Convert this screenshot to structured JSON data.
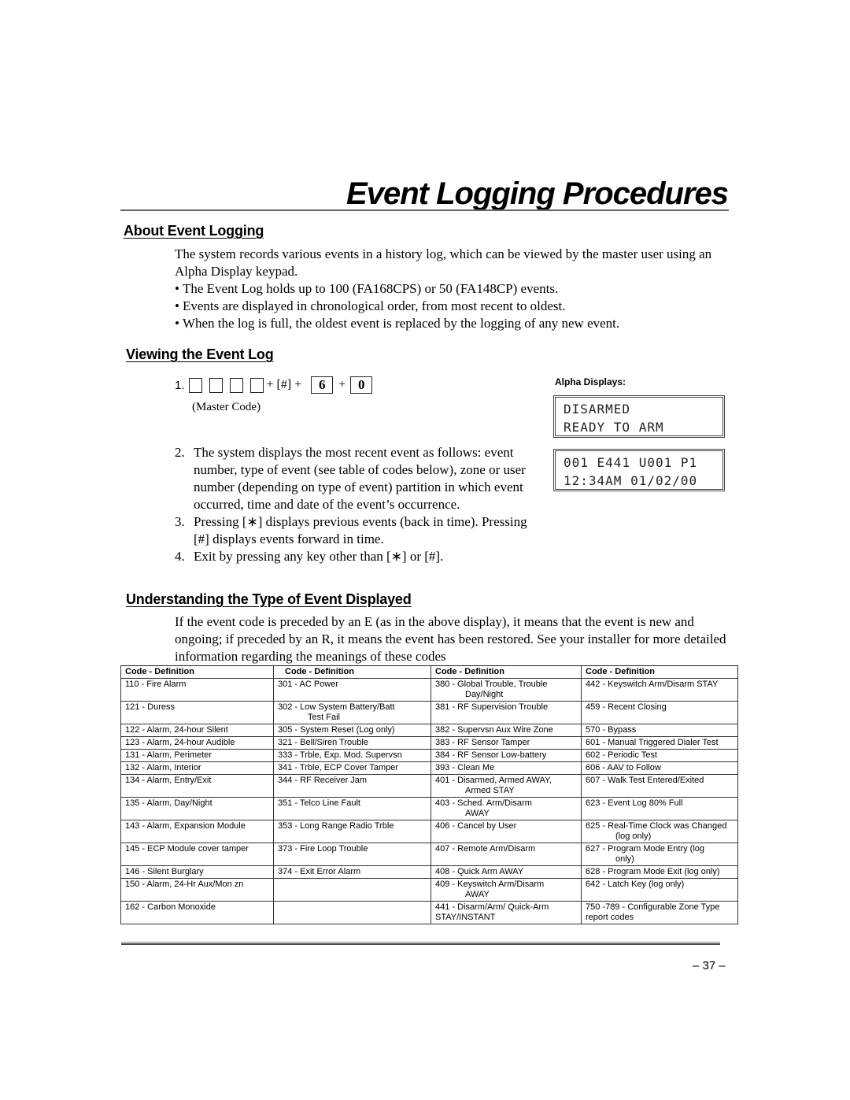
{
  "page": {
    "title": "Event Logging Procedures",
    "page_number": "– 37 –"
  },
  "about": {
    "heading": "About Event Logging",
    "intro": "The system records various events in a history log, which can be viewed by the master user using an Alpha Display keypad.",
    "bullets": [
      "The Event Log holds up to 100 (FA168CPS) or 50 (FA148CP) events.",
      "Events are displayed in chronological order, from most recent to oldest.",
      "When the log is full, the oldest event is replaced by the logging of any new event."
    ]
  },
  "viewing": {
    "heading": "Viewing the Event Log",
    "step1": {
      "number": "1.",
      "hash_key": "+ [#] +",
      "key_6": "6",
      "plus": "+",
      "key_0": "0",
      "master_code_label": "(Master Code)"
    },
    "steps": [
      {
        "n": "2.",
        "text": "The system displays the most recent event as follows: event number, type of event (see table of codes below), zone or user number (depending on type of event) partition in which event occurred, time and date of the event’s occurrence."
      },
      {
        "n": "3.",
        "text": "Pressing [∗] displays previous events (back in time). Pressing [#] displays events forward in time."
      },
      {
        "n": "4.",
        "text": "Exit by pressing any key other than [∗] or [#]."
      }
    ],
    "alpha_displays": {
      "label": "Alpha Displays:",
      "display_1": [
        "DISARMED",
        "READY TO ARM"
      ],
      "display_2": [
        "001 E441 U001 P1",
        "12:34AM 01/02/00"
      ]
    }
  },
  "understanding": {
    "heading": "Understanding the Type of Event Displayed",
    "text": "If the event code is preceded by an E (as in the above display), it means that the event is new and ongoing; if preceded by an R, it means the event has been restored. See your installer for more detailed information regarding the meanings of these codes"
  },
  "codes_table": {
    "headers": [
      "Code - Definition",
      "Code - Definition",
      "Code - Definition",
      "Code - Definition"
    ],
    "rows": [
      [
        "110 - Fire Alarm",
        "301 - AC Power",
        "380 - Global Trouble, Trouble|Day/Night",
        "442 - Keyswitch Arm/Disarm STAY"
      ],
      [
        "121 - Duress",
        "302 - Low System Battery/Batt|Test Fail",
        "381 - RF Supervision Trouble",
        "459 - Recent Closing"
      ],
      [
        "122 - Alarm, 24-hour Silent",
        "305 - System Reset (Log only)",
        "382 - Supervsn Aux Wire Zone",
        "570 - Bypass"
      ],
      [
        "123 - Alarm, 24-hour Audible",
        "321 - Bell/Siren Trouble",
        "383 - RF Sensor Tamper",
        "601 - Manual Triggered Dialer Test"
      ],
      [
        "131 - Alarm, Perimeter",
        "333 - Trble, Exp. Mod. Supervsn",
        "384 - RF Sensor Low-battery",
        "602 - Periodic Test"
      ],
      [
        "132 - Alarm, Interior",
        "341 - Trble, ECP Cover Tamper",
        "393 - Clean Me",
        "606 - AAV to Follow"
      ],
      [
        "134 - Alarm, Entry/Exit",
        "344 - RF Receiver Jam",
        "401 - Disarmed, Armed AWAY,|Armed STAY",
        "607 - Walk Test Entered/Exited"
      ],
      [
        "135 - Alarm, Day/Night",
        "351 - Telco Line Fault",
        "403 - Sched. Arm/Disarm|AWAY",
        "623 - Event Log 80% Full"
      ],
      [
        "143 - Alarm, Expansion Module",
        "353 - Long Range Radio Trble",
        "406 - Cancel by User",
        "625 - Real-Time Clock was Changed|(log only)"
      ],
      [
        "145 - ECP Module cover tamper",
        "373 - Fire Loop Trouble",
        "407 - Remote Arm/Disarm",
        "627 - Program Mode Entry (log|only)"
      ],
      [
        "146 - Silent Burglary",
        "374 - Exit Error Alarm",
        "408 - Quick Arm AWAY",
        "628 - Program Mode Exit (log only)"
      ],
      [
        "150 - Alarm, 24-Hr Aux/Mon zn",
        "",
        "409 - Keyswitch Arm/Disarm|AWAY",
        "642 - Latch Key (log only)"
      ],
      [
        "162 - Carbon Monoxide",
        "",
        "441 - Disarm/Arm/ Quick-Arm||STAY/INSTANT",
        "750 -789 - Configurable Zone Type||report codes"
      ]
    ],
    "tall_rows": [
      0,
      1,
      6,
      7,
      8,
      9,
      11,
      12
    ]
  }
}
